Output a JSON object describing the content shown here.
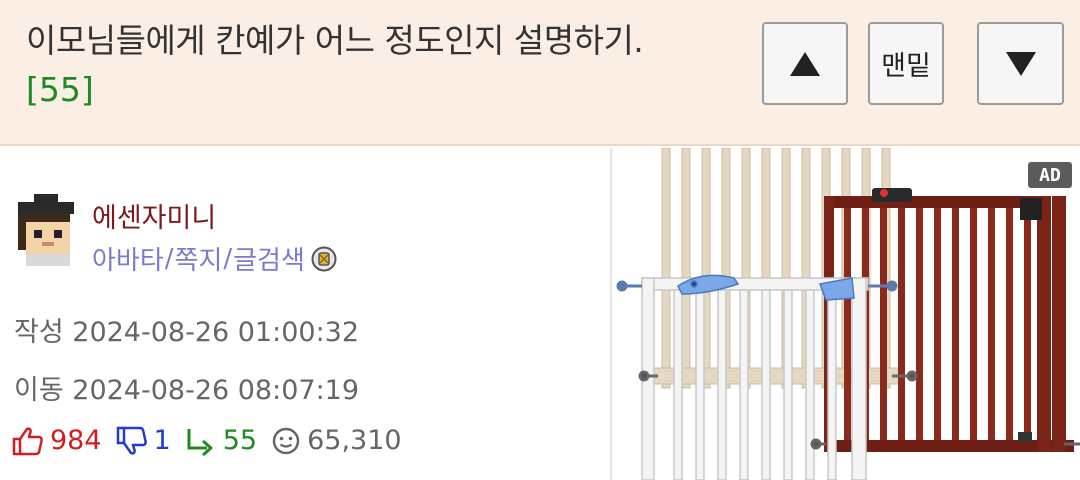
{
  "header": {
    "title": "이모님들에게 칸예가 어느 정도인지 설명하기.",
    "comment_count": "[55]",
    "top_button_label": "맨밑"
  },
  "author": {
    "nickname": "에센자미니",
    "links": [
      "아바타",
      "쪽지",
      "글검색"
    ],
    "separator": "/"
  },
  "meta": {
    "created": "작성 2024-08-26 01:00:32",
    "moved": "이동 2024-08-26 08:07:19"
  },
  "stats": {
    "upvotes": "984",
    "downvotes": "1",
    "replies": "55",
    "views": "65,310"
  },
  "ad": {
    "badge": "AD"
  },
  "colors": {
    "header_bg": "#fbefe5",
    "nickname": "#7a1a1a",
    "links": "#7a7ad0",
    "upvote": "#d21e1e",
    "downvote": "#1e3bd2",
    "reply": "#1f8a1f"
  },
  "icons": [
    "arrow-up-icon",
    "arrow-down-icon",
    "badge-icon",
    "thumbs-up-icon",
    "thumbs-down-icon",
    "reply-icon",
    "views-icon"
  ]
}
